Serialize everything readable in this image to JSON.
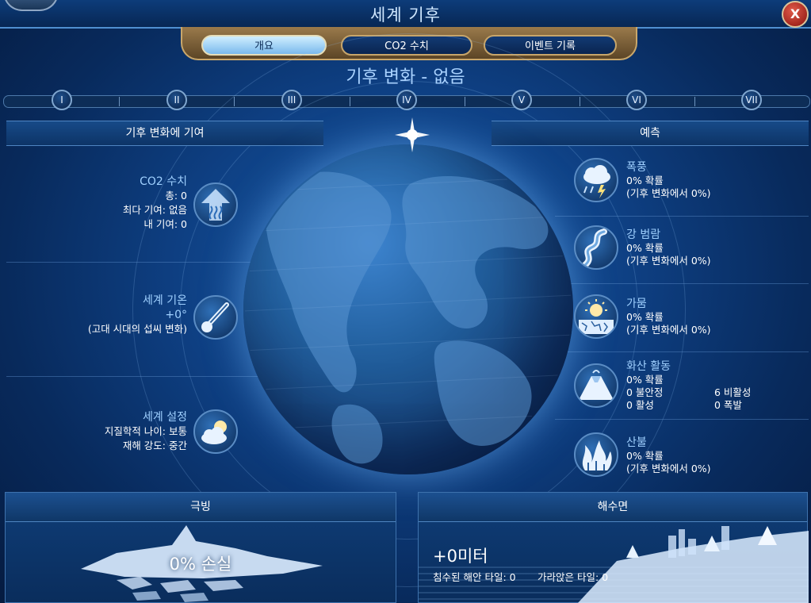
{
  "window": {
    "title": "세계 기후",
    "close_label": "X"
  },
  "tabs": [
    {
      "label": "개요",
      "active": true
    },
    {
      "label": "CO2 수치",
      "active": false
    },
    {
      "label": "이벤트 기록",
      "active": false
    }
  ],
  "subtitle": "기후 변화 - 없음",
  "eras": [
    "I",
    "II",
    "III",
    "IV",
    "V",
    "VI",
    "VII"
  ],
  "left_panel": {
    "header": "기후 변화에 기여",
    "co2": {
      "title": "CO2 수치",
      "total": "총: 0",
      "top": "최다 기여: 없음",
      "mine": "내 기여: 0",
      "icon": "co2-rising-icon"
    },
    "temperature": {
      "title": "세계 기온",
      "value": "+0°",
      "note": "(고대 시대의 섭씨 변화)",
      "icon": "thermometer-icon"
    },
    "settings": {
      "title": "세계 설정",
      "age": "지질학적 나이: 보통",
      "disaster": "재해 강도: 중간",
      "icon": "sun-cloud-icon"
    }
  },
  "right_panel": {
    "header": "예측",
    "items": [
      {
        "title": "폭풍",
        "chance": "0% 확률",
        "detail": "(기후 변화에서 0%)",
        "icon": "storm-icon"
      },
      {
        "title": "강 범람",
        "chance": "0% 확률",
        "detail": "(기후 변화에서 0%)",
        "icon": "river-flood-icon"
      },
      {
        "title": "가뭄",
        "chance": "0% 확률",
        "detail": "(기후 변화에서 0%)",
        "icon": "drought-icon"
      },
      {
        "title": "화산 활동",
        "chance": "0% 확률",
        "unstable": "0 불안정",
        "active": "0 활성",
        "inactive": "6 비활성",
        "eruption": "0 폭발",
        "icon": "volcano-icon"
      },
      {
        "title": "산불",
        "chance": "0% 확률",
        "detail": "(기후 변화에서 0%)",
        "icon": "wildfire-icon"
      }
    ]
  },
  "polar": {
    "header": "극빙",
    "loss": "0% 손실"
  },
  "sea_level": {
    "header": "해수면",
    "value": "+0미터",
    "flooded": "침수된 해안 타일: 0",
    "sunk": "가라앉은 타일: 0"
  },
  "colors": {
    "accent": "#9fd0ff",
    "gold": "#c9a76b",
    "panel": "#0d3467"
  }
}
